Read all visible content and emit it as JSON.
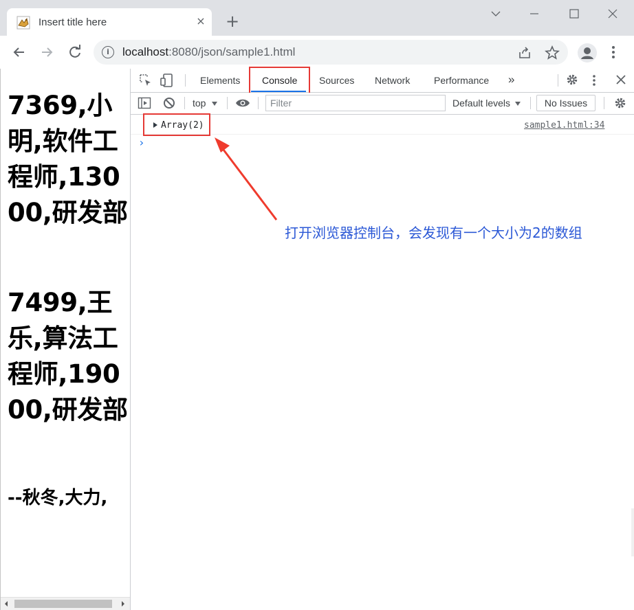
{
  "browser": {
    "tab_title": "Insert title here",
    "tab_close": "×",
    "new_tab": "+",
    "url_host": "localhost",
    "url_path": ":8080/json/sample1.html"
  },
  "devtools": {
    "tabs": [
      "Elements",
      "Console",
      "Sources",
      "Network",
      "Performance"
    ],
    "more_tabs": "»",
    "context": "top",
    "filter_placeholder": "Filter",
    "levels": "Default levels",
    "issues": "No Issues",
    "console_entry": "Array(2)",
    "console_source": "sample1.html:34",
    "prompt": "›"
  },
  "page": {
    "employees": [
      "7369,小明,软件工程师,13000,研发部",
      "7499,王乐,算法工程师,19000,研发部"
    ],
    "signature": "--秋冬,大力,"
  },
  "annotation": "打开浏览器控制台，会发现有一个大小为2的数组",
  "colors": {
    "accent": "#1a73e8",
    "highlight_red": "#e53935",
    "annotation_blue": "#2b58d6"
  }
}
